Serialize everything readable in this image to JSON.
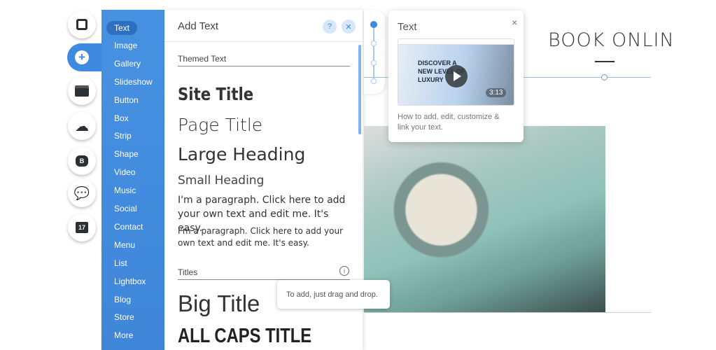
{
  "toolbar": {
    "items": [
      {
        "icon": "square-icon"
      },
      {
        "icon": "plus-circle-icon",
        "active": true
      },
      {
        "icon": "store-icon"
      },
      {
        "icon": "cloud-upload-icon"
      },
      {
        "icon": "blog-b-icon",
        "label": "B"
      },
      {
        "icon": "chat-sound-icon"
      },
      {
        "icon": "calendar-icon",
        "label": "17"
      }
    ]
  },
  "categories": [
    "Text",
    "Image",
    "Gallery",
    "Slideshow",
    "Button",
    "Box",
    "Strip",
    "Shape",
    "Video",
    "Music",
    "Social",
    "Contact",
    "Menu",
    "List",
    "Lightbox",
    "Blog",
    "Store",
    "More"
  ],
  "panel": {
    "title": "Add Text",
    "help": "?",
    "close": "✕",
    "themed_label": "Themed Text",
    "site_title": "Site Title",
    "page_title": "Page Title",
    "large_heading": "Large Heading",
    "small_heading": "Small Heading",
    "paragraph1": "I'm a paragraph. Click here to add your own text and edit me. It's easy.",
    "paragraph2": "I'm a paragraph. Click here to add your own text and edit me. It's easy.",
    "titles_label": "Titles",
    "info": "i",
    "big_title": "Big Title",
    "caps_title": "ALL CAPS TITLE"
  },
  "card": {
    "title": "Text",
    "close": "×",
    "video_text": "DISCOVER A NEW LEVEL OF LUXURY",
    "duration": "3:13",
    "description": "How to add, edit, customize & link your text."
  },
  "tooltip": "To add, just drag and drop.",
  "site": {
    "heading": "BOOK ONLIN"
  },
  "colors": {
    "accent": "#3d8ae0",
    "category_bg": "#4791e3"
  }
}
